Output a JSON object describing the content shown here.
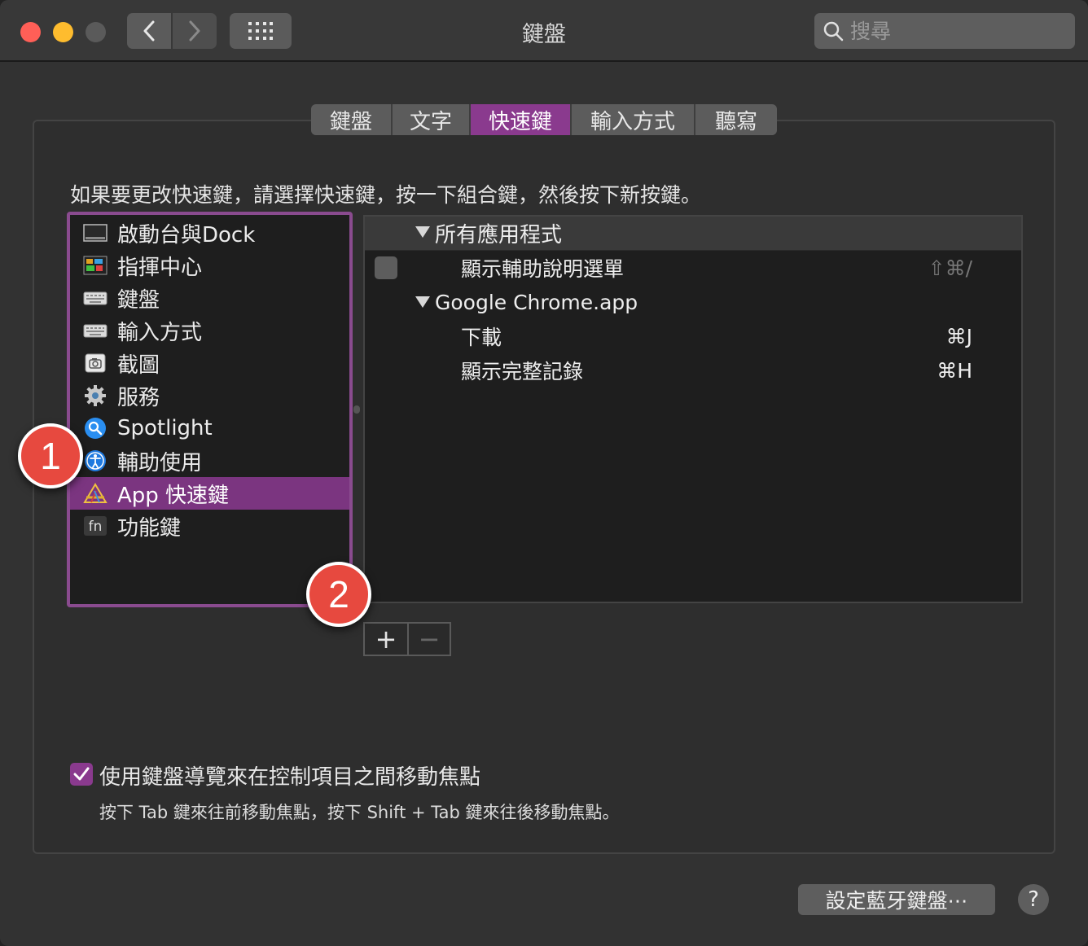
{
  "window": {
    "title": "鍵盤",
    "search_placeholder": "搜尋"
  },
  "tabs": [
    {
      "label": "鍵盤",
      "width": 100
    },
    {
      "label": "文字",
      "width": 96
    },
    {
      "label": "快速鍵",
      "width": 124,
      "active": true
    },
    {
      "label": "輸入方式",
      "width": 152
    },
    {
      "label": "聽寫",
      "width": 100
    }
  ],
  "instruction": "如果要更改快速鍵，請選擇快速鍵，按一下組合鍵，然後按下新按鍵。",
  "categories": [
    {
      "label": "啟動台與Dock",
      "icon": "launchpad-dock-icon"
    },
    {
      "label": "指揮中心",
      "icon": "mission-control-icon"
    },
    {
      "label": "鍵盤",
      "icon": "keyboard-icon"
    },
    {
      "label": "輸入方式",
      "icon": "input-sources-icon"
    },
    {
      "label": "截圖",
      "icon": "screenshot-icon"
    },
    {
      "label": "服務",
      "icon": "gear-icon"
    },
    {
      "label": "Spotlight",
      "icon": "spotlight-icon"
    },
    {
      "label": "輔助使用",
      "icon": "accessibility-icon"
    },
    {
      "label": "App 快速鍵",
      "icon": "app-shortcuts-icon",
      "selected": true
    },
    {
      "label": "功能鍵",
      "icon": "fn-key-icon"
    }
  ],
  "shortcuts": {
    "group1": {
      "label": "所有應用程式"
    },
    "group1_items": [
      {
        "label": "顯示輔助說明選單",
        "key": "⇧⌘/"
      }
    ],
    "group2": {
      "label": "Google Chrome.app"
    },
    "group2_items": [
      {
        "label": "下載",
        "key": "⌘J"
      },
      {
        "label": "顯示完整記錄",
        "key": "⌘H"
      }
    ]
  },
  "buttons": {
    "add": "+",
    "remove": "−",
    "bluetooth": "設定藍牙鍵盤⋯",
    "help": "?"
  },
  "keyboard_nav": {
    "label": "使用鍵盤導覽來在控制項目之間移動焦點",
    "hint": "按下 Tab 鍵來往前移動焦點，按下 Shift + Tab 鍵來往後移動焦點。"
  },
  "badges": {
    "one": "1",
    "two": "2"
  },
  "colors": {
    "accent": "#8a3a8e",
    "badge": "#e7493f"
  }
}
